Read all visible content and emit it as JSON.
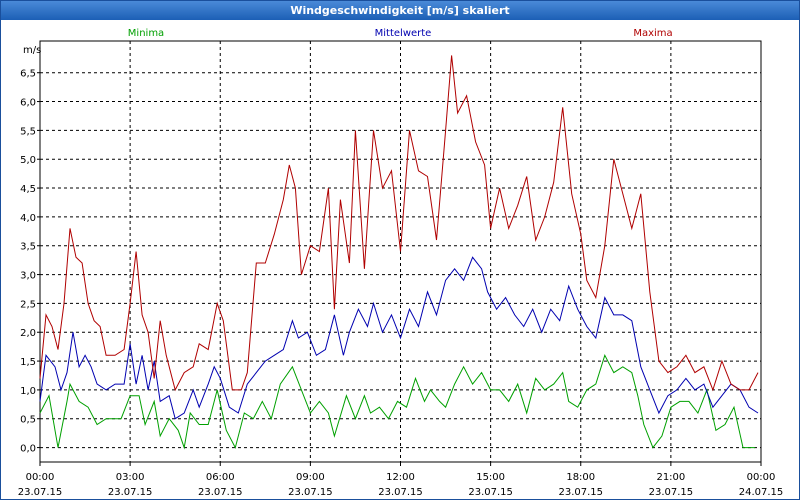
{
  "window": {
    "title": "Windgeschwindigkeit [m/s] skaliert"
  },
  "chart_data": {
    "type": "line",
    "title": "Windgeschwindigkeit [m/s] skaliert",
    "ylabel": "m/s",
    "ylim": [
      -0.25,
      7.05
    ],
    "yticks": [
      "0,0",
      "0,5",
      "1,0",
      "1,5",
      "2,0",
      "2,5",
      "3,0",
      "3,5",
      "4,0",
      "4,5",
      "5,0",
      "5,5",
      "6,0",
      "6,5"
    ],
    "xlim": [
      0,
      24
    ],
    "xticks": [
      {
        "time": "00:00",
        "date": "23.07.15"
      },
      {
        "time": "03:00",
        "date": "23.07.15"
      },
      {
        "time": "06:00",
        "date": "23.07.15"
      },
      {
        "time": "09:00",
        "date": "23.07.15"
      },
      {
        "time": "12:00",
        "date": "23.07.15"
      },
      {
        "time": "15:00",
        "date": "23.07.15"
      },
      {
        "time": "18:00",
        "date": "23.07.15"
      },
      {
        "time": "21:00",
        "date": "23.07.15"
      },
      {
        "time": "00:00",
        "date": "24.07.15"
      }
    ],
    "legend_position": "top",
    "grid": true,
    "series": [
      {
        "name": "Minima",
        "color": "#00a000",
        "points": [
          [
            0,
            0.6
          ],
          [
            0.3,
            0.9
          ],
          [
            0.6,
            0.0
          ],
          [
            0.9,
            0.8
          ],
          [
            1.0,
            1.1
          ],
          [
            1.3,
            0.8
          ],
          [
            1.6,
            0.7
          ],
          [
            1.9,
            0.4
          ],
          [
            2.2,
            0.5
          ],
          [
            2.5,
            0.5
          ],
          [
            2.7,
            0.5
          ],
          [
            3.0,
            0.9
          ],
          [
            3.3,
            0.9
          ],
          [
            3.5,
            0.4
          ],
          [
            3.8,
            0.8
          ],
          [
            4.0,
            0.2
          ],
          [
            4.3,
            0.5
          ],
          [
            4.6,
            0.3
          ],
          [
            4.8,
            0.0
          ],
          [
            5.0,
            0.6
          ],
          [
            5.3,
            0.4
          ],
          [
            5.6,
            0.4
          ],
          [
            5.9,
            1.0
          ],
          [
            6.2,
            0.3
          ],
          [
            6.5,
            0.0
          ],
          [
            6.8,
            0.6
          ],
          [
            7.1,
            0.5
          ],
          [
            7.4,
            0.8
          ],
          [
            7.7,
            0.5
          ],
          [
            8.0,
            1.1
          ],
          [
            8.4,
            1.4
          ],
          [
            8.7,
            1.0
          ],
          [
            9.0,
            0.6
          ],
          [
            9.3,
            0.8
          ],
          [
            9.6,
            0.6
          ],
          [
            9.8,
            0.2
          ],
          [
            10.2,
            0.9
          ],
          [
            10.5,
            0.5
          ],
          [
            10.8,
            0.9
          ],
          [
            11.0,
            0.6
          ],
          [
            11.3,
            0.7
          ],
          [
            11.6,
            0.5
          ],
          [
            11.9,
            0.8
          ],
          [
            12.2,
            0.7
          ],
          [
            12.5,
            1.2
          ],
          [
            12.8,
            0.8
          ],
          [
            13.0,
            1.0
          ],
          [
            13.3,
            0.8
          ],
          [
            13.5,
            0.7
          ],
          [
            13.8,
            1.1
          ],
          [
            14.1,
            1.4
          ],
          [
            14.4,
            1.1
          ],
          [
            14.7,
            1.3
          ],
          [
            15.0,
            1.0
          ],
          [
            15.3,
            1.0
          ],
          [
            15.6,
            0.8
          ],
          [
            15.9,
            1.1
          ],
          [
            16.2,
            0.6
          ],
          [
            16.5,
            1.2
          ],
          [
            16.8,
            1.0
          ],
          [
            17.1,
            1.1
          ],
          [
            17.4,
            1.3
          ],
          [
            17.6,
            0.8
          ],
          [
            17.9,
            0.7
          ],
          [
            18.2,
            1.0
          ],
          [
            18.5,
            1.1
          ],
          [
            18.8,
            1.6
          ],
          [
            19.1,
            1.3
          ],
          [
            19.4,
            1.4
          ],
          [
            19.7,
            1.3
          ],
          [
            19.9,
            0.9
          ],
          [
            20.1,
            0.4
          ],
          [
            20.4,
            0.0
          ],
          [
            20.7,
            0.2
          ],
          [
            21.0,
            0.7
          ],
          [
            21.3,
            0.8
          ],
          [
            21.6,
            0.8
          ],
          [
            21.9,
            0.6
          ],
          [
            22.2,
            1.0
          ],
          [
            22.5,
            0.3
          ],
          [
            22.8,
            0.4
          ],
          [
            23.1,
            0.7
          ],
          [
            23.4,
            0.0
          ],
          [
            23.8,
            0.0
          ]
        ]
      },
      {
        "name": "Mittelwerte",
        "color": "#0000b0",
        "points": [
          [
            0,
            0.8
          ],
          [
            0.2,
            1.6
          ],
          [
            0.5,
            1.4
          ],
          [
            0.7,
            1.0
          ],
          [
            0.9,
            1.3
          ],
          [
            1.1,
            2.0
          ],
          [
            1.3,
            1.4
          ],
          [
            1.5,
            1.6
          ],
          [
            1.7,
            1.4
          ],
          [
            1.9,
            1.1
          ],
          [
            2.2,
            1.0
          ],
          [
            2.5,
            1.1
          ],
          [
            2.8,
            1.1
          ],
          [
            3.0,
            1.8
          ],
          [
            3.2,
            1.1
          ],
          [
            3.4,
            1.6
          ],
          [
            3.6,
            1.0
          ],
          [
            3.8,
            1.5
          ],
          [
            4.0,
            0.8
          ],
          [
            4.3,
            0.9
          ],
          [
            4.5,
            0.5
          ],
          [
            4.8,
            0.6
          ],
          [
            5.1,
            1.0
          ],
          [
            5.3,
            0.7
          ],
          [
            5.6,
            1.1
          ],
          [
            5.8,
            1.4
          ],
          [
            6.0,
            1.2
          ],
          [
            6.3,
            0.7
          ],
          [
            6.6,
            0.6
          ],
          [
            6.9,
            1.1
          ],
          [
            7.2,
            1.3
          ],
          [
            7.5,
            1.5
          ],
          [
            7.8,
            1.6
          ],
          [
            8.1,
            1.7
          ],
          [
            8.4,
            2.2
          ],
          [
            8.6,
            1.9
          ],
          [
            8.9,
            2.0
          ],
          [
            9.2,
            1.6
          ],
          [
            9.5,
            1.7
          ],
          [
            9.8,
            2.3
          ],
          [
            10.1,
            1.6
          ],
          [
            10.3,
            2.0
          ],
          [
            10.6,
            2.4
          ],
          [
            10.9,
            2.1
          ],
          [
            11.1,
            2.5
          ],
          [
            11.4,
            2.0
          ],
          [
            11.7,
            2.3
          ],
          [
            12.0,
            1.9
          ],
          [
            12.3,
            2.4
          ],
          [
            12.6,
            2.1
          ],
          [
            12.9,
            2.7
          ],
          [
            13.2,
            2.3
          ],
          [
            13.5,
            2.9
          ],
          [
            13.8,
            3.1
          ],
          [
            14.1,
            2.9
          ],
          [
            14.4,
            3.3
          ],
          [
            14.7,
            3.1
          ],
          [
            14.9,
            2.7
          ],
          [
            15.2,
            2.4
          ],
          [
            15.5,
            2.6
          ],
          [
            15.8,
            2.3
          ],
          [
            16.1,
            2.1
          ],
          [
            16.4,
            2.4
          ],
          [
            16.7,
            2.0
          ],
          [
            17.0,
            2.4
          ],
          [
            17.3,
            2.2
          ],
          [
            17.6,
            2.8
          ],
          [
            17.9,
            2.4
          ],
          [
            18.2,
            2.1
          ],
          [
            18.5,
            1.9
          ],
          [
            18.8,
            2.6
          ],
          [
            19.1,
            2.3
          ],
          [
            19.4,
            2.3
          ],
          [
            19.7,
            2.2
          ],
          [
            20.0,
            1.4
          ],
          [
            20.3,
            1.0
          ],
          [
            20.6,
            0.6
          ],
          [
            20.9,
            0.9
          ],
          [
            21.2,
            1.0
          ],
          [
            21.5,
            1.2
          ],
          [
            21.8,
            1.0
          ],
          [
            22.1,
            1.1
          ],
          [
            22.4,
            0.7
          ],
          [
            22.7,
            0.9
          ],
          [
            23.0,
            1.1
          ],
          [
            23.3,
            1.0
          ],
          [
            23.6,
            0.7
          ],
          [
            23.9,
            0.6
          ]
        ]
      },
      {
        "name": "Maxima",
        "color": "#b00000",
        "points": [
          [
            0,
            1.2
          ],
          [
            0.2,
            2.3
          ],
          [
            0.4,
            2.1
          ],
          [
            0.6,
            1.7
          ],
          [
            0.8,
            2.5
          ],
          [
            1.0,
            3.8
          ],
          [
            1.2,
            3.3
          ],
          [
            1.4,
            3.2
          ],
          [
            1.6,
            2.5
          ],
          [
            1.8,
            2.2
          ],
          [
            2.0,
            2.1
          ],
          [
            2.2,
            1.6
          ],
          [
            2.5,
            1.6
          ],
          [
            2.8,
            1.7
          ],
          [
            3.0,
            2.5
          ],
          [
            3.2,
            3.4
          ],
          [
            3.4,
            2.3
          ],
          [
            3.6,
            2.0
          ],
          [
            3.8,
            1.2
          ],
          [
            4.0,
            2.2
          ],
          [
            4.2,
            1.6
          ],
          [
            4.5,
            1.0
          ],
          [
            4.8,
            1.3
          ],
          [
            5.1,
            1.4
          ],
          [
            5.3,
            1.8
          ],
          [
            5.6,
            1.7
          ],
          [
            5.9,
            2.5
          ],
          [
            6.1,
            2.2
          ],
          [
            6.4,
            1.0
          ],
          [
            6.7,
            1.0
          ],
          [
            6.9,
            1.3
          ],
          [
            7.2,
            3.2
          ],
          [
            7.5,
            3.2
          ],
          [
            7.8,
            3.7
          ],
          [
            8.1,
            4.3
          ],
          [
            8.3,
            4.9
          ],
          [
            8.5,
            4.5
          ],
          [
            8.7,
            3.0
          ],
          [
            9.0,
            3.5
          ],
          [
            9.3,
            3.4
          ],
          [
            9.6,
            4.5
          ],
          [
            9.8,
            2.4
          ],
          [
            10.0,
            4.3
          ],
          [
            10.3,
            3.2
          ],
          [
            10.5,
            5.5
          ],
          [
            10.8,
            3.1
          ],
          [
            11.1,
            5.5
          ],
          [
            11.4,
            4.5
          ],
          [
            11.7,
            4.8
          ],
          [
            12.0,
            3.4
          ],
          [
            12.3,
            5.5
          ],
          [
            12.6,
            4.8
          ],
          [
            12.9,
            4.7
          ],
          [
            13.2,
            3.6
          ],
          [
            13.5,
            5.5
          ],
          [
            13.7,
            6.8
          ],
          [
            13.9,
            5.8
          ],
          [
            14.2,
            6.1
          ],
          [
            14.5,
            5.3
          ],
          [
            14.8,
            4.9
          ],
          [
            15.0,
            3.8
          ],
          [
            15.3,
            4.5
          ],
          [
            15.6,
            3.8
          ],
          [
            15.9,
            4.2
          ],
          [
            16.2,
            4.7
          ],
          [
            16.5,
            3.6
          ],
          [
            16.8,
            4.0
          ],
          [
            17.1,
            4.6
          ],
          [
            17.4,
            5.9
          ],
          [
            17.7,
            4.4
          ],
          [
            18.0,
            3.7
          ],
          [
            18.2,
            2.9
          ],
          [
            18.5,
            2.6
          ],
          [
            18.8,
            3.5
          ],
          [
            19.1,
            5.0
          ],
          [
            19.4,
            4.4
          ],
          [
            19.7,
            3.8
          ],
          [
            20.0,
            4.4
          ],
          [
            20.3,
            2.7
          ],
          [
            20.6,
            1.5
          ],
          [
            20.9,
            1.3
          ],
          [
            21.2,
            1.4
          ],
          [
            21.5,
            1.6
          ],
          [
            21.8,
            1.3
          ],
          [
            22.1,
            1.4
          ],
          [
            22.4,
            1.0
          ],
          [
            22.7,
            1.5
          ],
          [
            23.0,
            1.1
          ],
          [
            23.3,
            1.0
          ],
          [
            23.6,
            1.0
          ],
          [
            23.9,
            1.3
          ]
        ]
      }
    ]
  }
}
